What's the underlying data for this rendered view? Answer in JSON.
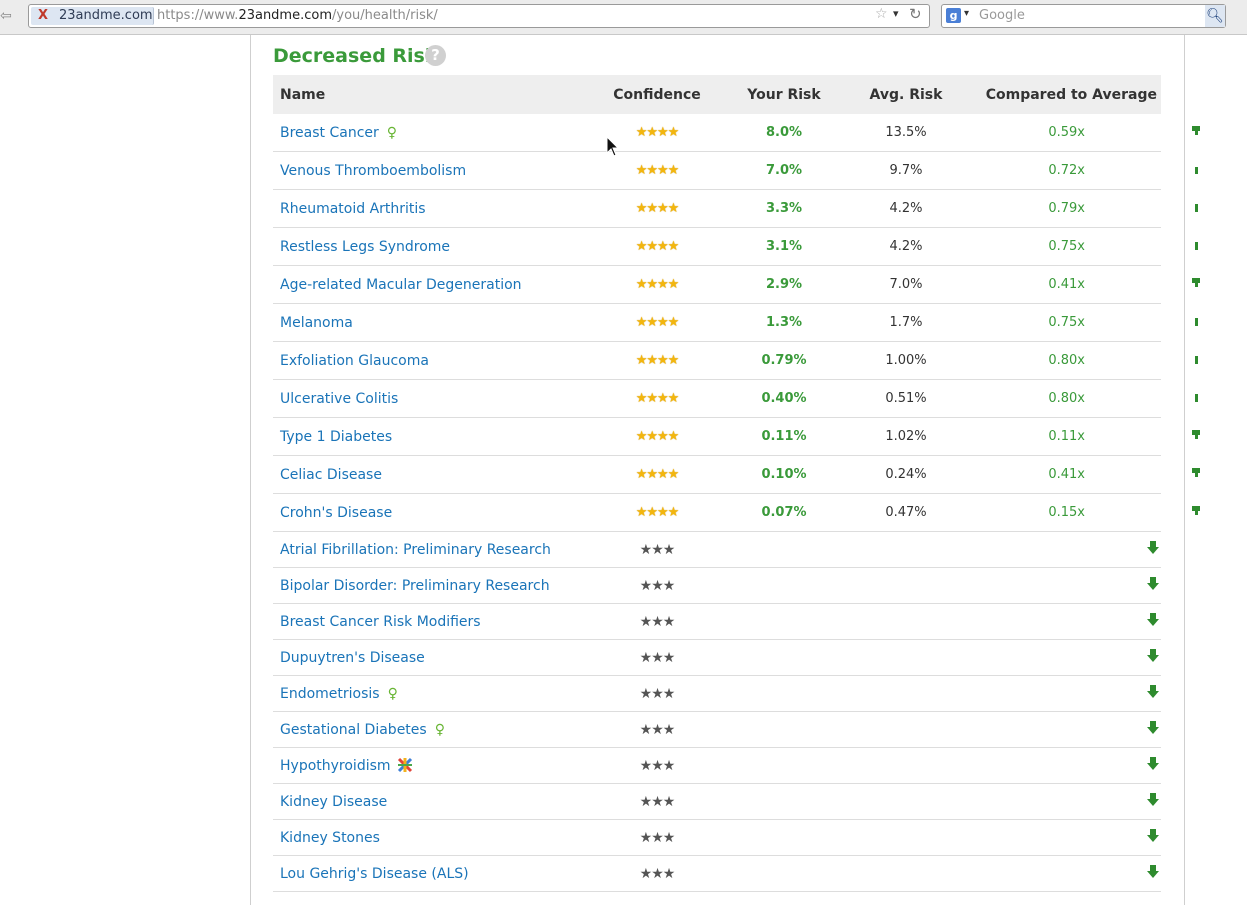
{
  "browser": {
    "site_badge": "23andme.com",
    "url_prefix": "https://www.",
    "url_domain": "23andme.com",
    "url_path": "/you/health/risk/",
    "search_placeholder": "Google"
  },
  "section": {
    "title": "Decreased Risk",
    "help_glyph": "?"
  },
  "table": {
    "headers": {
      "name": "Name",
      "confidence": "Confidence",
      "your_risk": "Your Risk",
      "avg_risk": "Avg. Risk",
      "compared": "Compared to Average"
    },
    "rated_rows": [
      {
        "name": "Breast Cancer",
        "sex": "female",
        "stars": "★★★★",
        "your": "8.0%",
        "avg": "13.5%",
        "ratio": "0.59x",
        "bar": 0.59
      },
      {
        "name": "Venous Thromboembolism",
        "stars": "★★★★",
        "your": "7.0%",
        "avg": "9.7%",
        "ratio": "0.72x",
        "bar": 0.72
      },
      {
        "name": "Rheumatoid Arthritis",
        "stars": "★★★★",
        "your": "3.3%",
        "avg": "4.2%",
        "ratio": "0.79x",
        "bar": 0.79
      },
      {
        "name": "Restless Legs Syndrome",
        "stars": "★★★★",
        "your": "3.1%",
        "avg": "4.2%",
        "ratio": "0.75x",
        "bar": 0.75
      },
      {
        "name": "Age-related Macular Degeneration",
        "stars": "★★★★",
        "your": "2.9%",
        "avg": "7.0%",
        "ratio": "0.41x",
        "bar": 0.41
      },
      {
        "name": "Melanoma",
        "stars": "★★★★",
        "your": "1.3%",
        "avg": "1.7%",
        "ratio": "0.75x",
        "bar": 0.75
      },
      {
        "name": "Exfoliation Glaucoma",
        "stars": "★★★★",
        "your": "0.79%",
        "avg": "1.00%",
        "ratio": "0.80x",
        "bar": 0.8
      },
      {
        "name": "Ulcerative Colitis",
        "stars": "★★★★",
        "your": "0.40%",
        "avg": "0.51%",
        "ratio": "0.80x",
        "bar": 0.8
      },
      {
        "name": "Type 1 Diabetes",
        "stars": "★★★★",
        "your": "0.11%",
        "avg": "1.02%",
        "ratio": "0.11x",
        "bar": 0.11
      },
      {
        "name": "Celiac Disease",
        "stars": "★★★★",
        "your": "0.10%",
        "avg": "0.24%",
        "ratio": "0.41x",
        "bar": 0.41
      },
      {
        "name": "Crohn's Disease",
        "stars": "★★★★",
        "your": "0.07%",
        "avg": "0.47%",
        "ratio": "0.15x",
        "bar": 0.15
      }
    ],
    "preliminary_rows": [
      {
        "name": "Atrial Fibrillation: Preliminary Research",
        "stars": "★★★"
      },
      {
        "name": "Bipolar Disorder: Preliminary Research",
        "stars": "★★★"
      },
      {
        "name": "Breast Cancer Risk Modifiers",
        "stars": "★★★"
      },
      {
        "name": "Dupuytren's Disease",
        "stars": "★★★"
      },
      {
        "name": "Endometriosis",
        "sex": "female",
        "stars": "★★★"
      },
      {
        "name": "Gestational Diabetes",
        "sex": "female",
        "stars": "★★★"
      },
      {
        "name": "Hypothyroidism",
        "icon": "community-triangle-icon",
        "stars": "★★★"
      },
      {
        "name": "Kidney Disease",
        "stars": "★★★"
      },
      {
        "name": "Kidney Stones",
        "stars": "★★★"
      },
      {
        "name": "Lou Gehrig's Disease (ALS)",
        "stars": "★★★"
      }
    ],
    "decrease_arrow": "🡇"
  },
  "colors": {
    "green": "#3a9a3a",
    "link": "#1a74b8",
    "star_gold": "#f3b60e",
    "header_bg": "#eeeeee"
  }
}
